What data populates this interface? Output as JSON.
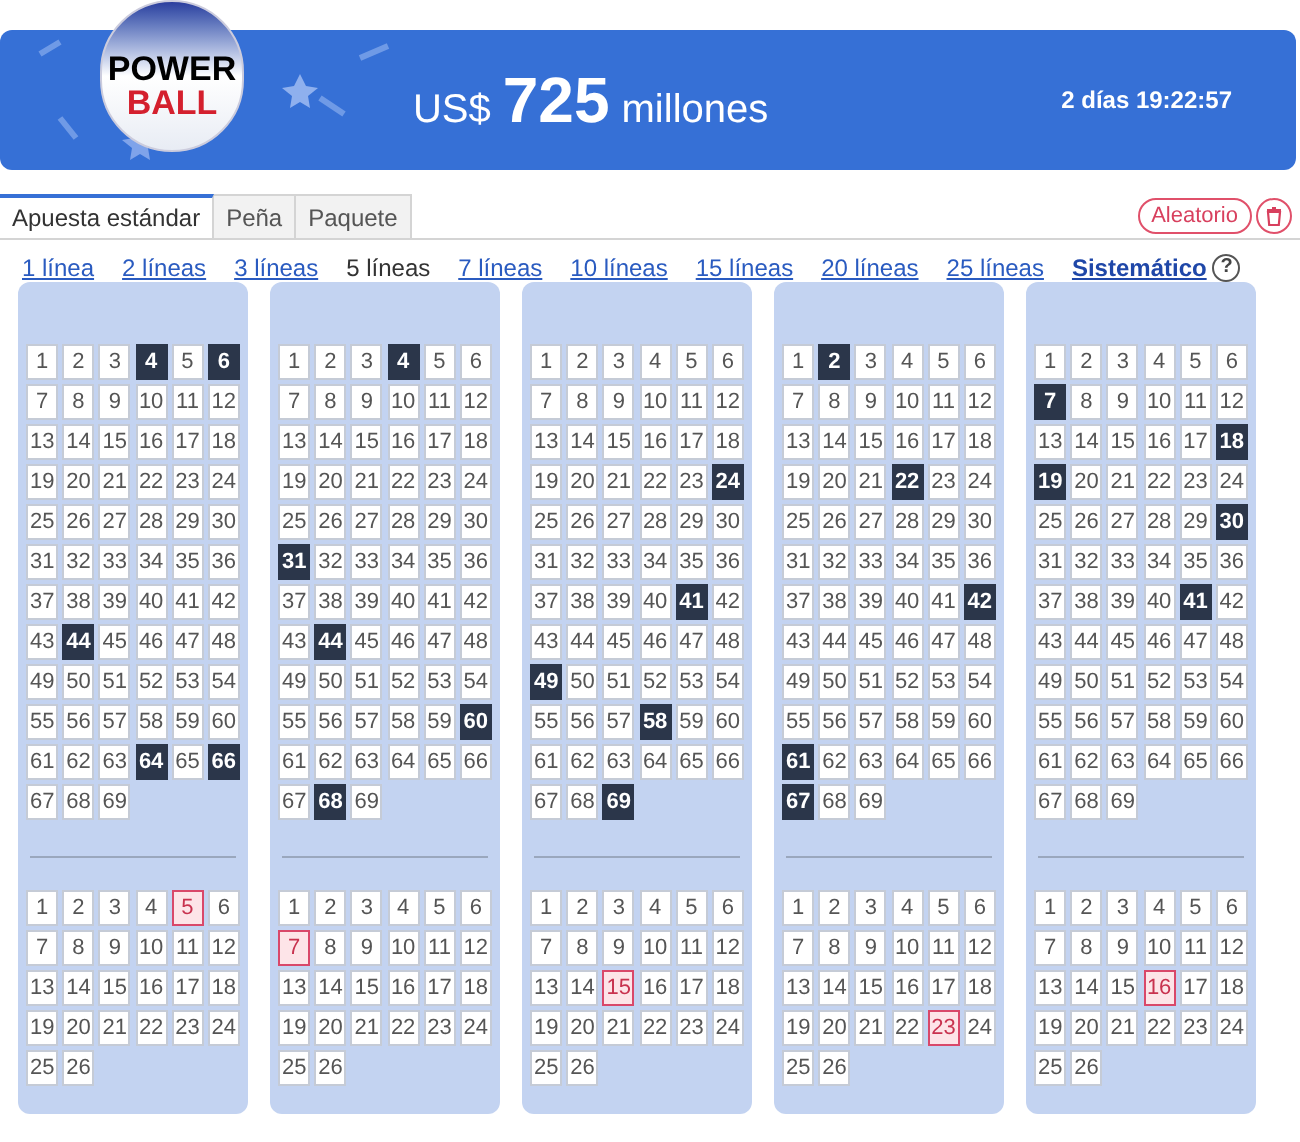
{
  "header": {
    "logo_top": "POWER",
    "logo_bottom": "BALL",
    "currency": "US$",
    "amount": "725",
    "unit": "millones",
    "countdown": "2 días 19:22:57"
  },
  "tabs": [
    {
      "label": "Apuesta estándar",
      "selected": true
    },
    {
      "label": "Peña",
      "selected": false
    },
    {
      "label": "Paquete",
      "selected": false
    }
  ],
  "actions": {
    "random": "Aleatorio"
  },
  "line_options": [
    {
      "label": "1 línea",
      "selected": false
    },
    {
      "label": "2 líneas",
      "selected": false
    },
    {
      "label": "3 líneas",
      "selected": false
    },
    {
      "label": "5 líneas",
      "selected": true
    },
    {
      "label": "7 líneas",
      "selected": false
    },
    {
      "label": "10 líneas",
      "selected": false
    },
    {
      "label": "15 líneas",
      "selected": false
    },
    {
      "label": "20 líneas",
      "selected": false
    },
    {
      "label": "25 líneas",
      "selected": false
    }
  ],
  "system_link": "Sistemático",
  "help": "?",
  "tickets": [
    {
      "main": [
        {
          "label": "1",
          "selected": false
        },
        {
          "label": "2",
          "selected": false
        },
        {
          "label": "3",
          "selected": false
        },
        {
          "label": "4",
          "selected": true
        },
        {
          "label": "5",
          "selected": false
        },
        {
          "label": "6",
          "selected": true
        },
        {
          "label": "7",
          "selected": false
        },
        {
          "label": "8",
          "selected": false
        },
        {
          "label": "9",
          "selected": false
        },
        {
          "label": "10",
          "selected": false
        },
        {
          "label": "11",
          "selected": false
        },
        {
          "label": "12",
          "selected": false
        },
        {
          "label": "13",
          "selected": false
        },
        {
          "label": "14",
          "selected": false
        },
        {
          "label": "15",
          "selected": false
        },
        {
          "label": "16",
          "selected": false
        },
        {
          "label": "17",
          "selected": false
        },
        {
          "label": "18",
          "selected": false
        },
        {
          "label": "19",
          "selected": false
        },
        {
          "label": "20",
          "selected": false
        },
        {
          "label": "21",
          "selected": false
        },
        {
          "label": "22",
          "selected": false
        },
        {
          "label": "23",
          "selected": false
        },
        {
          "label": "24",
          "selected": false
        },
        {
          "label": "25",
          "selected": false
        },
        {
          "label": "26",
          "selected": false
        },
        {
          "label": "27",
          "selected": false
        },
        {
          "label": "28",
          "selected": false
        },
        {
          "label": "29",
          "selected": false
        },
        {
          "label": "30",
          "selected": false
        },
        {
          "label": "31",
          "selected": false
        },
        {
          "label": "32",
          "selected": false
        },
        {
          "label": "33",
          "selected": false
        },
        {
          "label": "34",
          "selected": false
        },
        {
          "label": "35",
          "selected": false
        },
        {
          "label": "36",
          "selected": false
        },
        {
          "label": "37",
          "selected": false
        },
        {
          "label": "38",
          "selected": false
        },
        {
          "label": "39",
          "selected": false
        },
        {
          "label": "40",
          "selected": false
        },
        {
          "label": "41",
          "selected": false
        },
        {
          "label": "42",
          "selected": false
        },
        {
          "label": "43",
          "selected": false
        },
        {
          "label": "44",
          "selected": true
        },
        {
          "label": "45",
          "selected": false
        },
        {
          "label": "46",
          "selected": false
        },
        {
          "label": "47",
          "selected": false
        },
        {
          "label": "48",
          "selected": false
        },
        {
          "label": "49",
          "selected": false
        },
        {
          "label": "50",
          "selected": false
        },
        {
          "label": "51",
          "selected": false
        },
        {
          "label": "52",
          "selected": false
        },
        {
          "label": "53",
          "selected": false
        },
        {
          "label": "54",
          "selected": false
        },
        {
          "label": "55",
          "selected": false
        },
        {
          "label": "56",
          "selected": false
        },
        {
          "label": "57",
          "selected": false
        },
        {
          "label": "58",
          "selected": false
        },
        {
          "label": "59",
          "selected": false
        },
        {
          "label": "60",
          "selected": false
        },
        {
          "label": "61",
          "selected": false
        },
        {
          "label": "62",
          "selected": false
        },
        {
          "label": "63",
          "selected": false
        },
        {
          "label": "64",
          "selected": true
        },
        {
          "label": "65",
          "selected": false
        },
        {
          "label": "66",
          "selected": true
        },
        {
          "label": "67",
          "selected": false
        },
        {
          "label": "68",
          "selected": false
        },
        {
          "label": "69",
          "selected": false
        }
      ],
      "powerball": [
        {
          "label": "1",
          "selected": false
        },
        {
          "label": "2",
          "selected": false
        },
        {
          "label": "3",
          "selected": false
        },
        {
          "label": "4",
          "selected": false
        },
        {
          "label": "5",
          "selected": true
        },
        {
          "label": "6",
          "selected": false
        },
        {
          "label": "7",
          "selected": false
        },
        {
          "label": "8",
          "selected": false
        },
        {
          "label": "9",
          "selected": false
        },
        {
          "label": "10",
          "selected": false
        },
        {
          "label": "11",
          "selected": false
        },
        {
          "label": "12",
          "selected": false
        },
        {
          "label": "13",
          "selected": false
        },
        {
          "label": "14",
          "selected": false
        },
        {
          "label": "15",
          "selected": false
        },
        {
          "label": "16",
          "selected": false
        },
        {
          "label": "17",
          "selected": false
        },
        {
          "label": "18",
          "selected": false
        },
        {
          "label": "19",
          "selected": false
        },
        {
          "label": "20",
          "selected": false
        },
        {
          "label": "21",
          "selected": false
        },
        {
          "label": "22",
          "selected": false
        },
        {
          "label": "23",
          "selected": false
        },
        {
          "label": "24",
          "selected": false
        },
        {
          "label": "25",
          "selected": false
        },
        {
          "label": "26",
          "selected": false
        }
      ]
    },
    {
      "main": [
        {
          "label": "1",
          "selected": false
        },
        {
          "label": "2",
          "selected": false
        },
        {
          "label": "3",
          "selected": false
        },
        {
          "label": "4",
          "selected": true
        },
        {
          "label": "5",
          "selected": false
        },
        {
          "label": "6",
          "selected": false
        },
        {
          "label": "7",
          "selected": false
        },
        {
          "label": "8",
          "selected": false
        },
        {
          "label": "9",
          "selected": false
        },
        {
          "label": "10",
          "selected": false
        },
        {
          "label": "11",
          "selected": false
        },
        {
          "label": "12",
          "selected": false
        },
        {
          "label": "13",
          "selected": false
        },
        {
          "label": "14",
          "selected": false
        },
        {
          "label": "15",
          "selected": false
        },
        {
          "label": "16",
          "selected": false
        },
        {
          "label": "17",
          "selected": false
        },
        {
          "label": "18",
          "selected": false
        },
        {
          "label": "19",
          "selected": false
        },
        {
          "label": "20",
          "selected": false
        },
        {
          "label": "21",
          "selected": false
        },
        {
          "label": "22",
          "selected": false
        },
        {
          "label": "23",
          "selected": false
        },
        {
          "label": "24",
          "selected": false
        },
        {
          "label": "25",
          "selected": false
        },
        {
          "label": "26",
          "selected": false
        },
        {
          "label": "27",
          "selected": false
        },
        {
          "label": "28",
          "selected": false
        },
        {
          "label": "29",
          "selected": false
        },
        {
          "label": "30",
          "selected": false
        },
        {
          "label": "31",
          "selected": true
        },
        {
          "label": "32",
          "selected": false
        },
        {
          "label": "33",
          "selected": false
        },
        {
          "label": "34",
          "selected": false
        },
        {
          "label": "35",
          "selected": false
        },
        {
          "label": "36",
          "selected": false
        },
        {
          "label": "37",
          "selected": false
        },
        {
          "label": "38",
          "selected": false
        },
        {
          "label": "39",
          "selected": false
        },
        {
          "label": "40",
          "selected": false
        },
        {
          "label": "41",
          "selected": false
        },
        {
          "label": "42",
          "selected": false
        },
        {
          "label": "43",
          "selected": false
        },
        {
          "label": "44",
          "selected": true
        },
        {
          "label": "45",
          "selected": false
        },
        {
          "label": "46",
          "selected": false
        },
        {
          "label": "47",
          "selected": false
        },
        {
          "label": "48",
          "selected": false
        },
        {
          "label": "49",
          "selected": false
        },
        {
          "label": "50",
          "selected": false
        },
        {
          "label": "51",
          "selected": false
        },
        {
          "label": "52",
          "selected": false
        },
        {
          "label": "53",
          "selected": false
        },
        {
          "label": "54",
          "selected": false
        },
        {
          "label": "55",
          "selected": false
        },
        {
          "label": "56",
          "selected": false
        },
        {
          "label": "57",
          "selected": false
        },
        {
          "label": "58",
          "selected": false
        },
        {
          "label": "59",
          "selected": false
        },
        {
          "label": "60",
          "selected": true
        },
        {
          "label": "61",
          "selected": false
        },
        {
          "label": "62",
          "selected": false
        },
        {
          "label": "63",
          "selected": false
        },
        {
          "label": "64",
          "selected": false
        },
        {
          "label": "65",
          "selected": false
        },
        {
          "label": "66",
          "selected": false
        },
        {
          "label": "67",
          "selected": false
        },
        {
          "label": "68",
          "selected": true
        },
        {
          "label": "69",
          "selected": false
        }
      ],
      "powerball": [
        {
          "label": "1",
          "selected": false
        },
        {
          "label": "2",
          "selected": false
        },
        {
          "label": "3",
          "selected": false
        },
        {
          "label": "4",
          "selected": false
        },
        {
          "label": "5",
          "selected": false
        },
        {
          "label": "6",
          "selected": false
        },
        {
          "label": "7",
          "selected": true
        },
        {
          "label": "8",
          "selected": false
        },
        {
          "label": "9",
          "selected": false
        },
        {
          "label": "10",
          "selected": false
        },
        {
          "label": "11",
          "selected": false
        },
        {
          "label": "12",
          "selected": false
        },
        {
          "label": "13",
          "selected": false
        },
        {
          "label": "14",
          "selected": false
        },
        {
          "label": "15",
          "selected": false
        },
        {
          "label": "16",
          "selected": false
        },
        {
          "label": "17",
          "selected": false
        },
        {
          "label": "18",
          "selected": false
        },
        {
          "label": "19",
          "selected": false
        },
        {
          "label": "20",
          "selected": false
        },
        {
          "label": "21",
          "selected": false
        },
        {
          "label": "22",
          "selected": false
        },
        {
          "label": "23",
          "selected": false
        },
        {
          "label": "24",
          "selected": false
        },
        {
          "label": "25",
          "selected": false
        },
        {
          "label": "26",
          "selected": false
        }
      ]
    },
    {
      "main": [
        {
          "label": "1",
          "selected": false
        },
        {
          "label": "2",
          "selected": false
        },
        {
          "label": "3",
          "selected": false
        },
        {
          "label": "4",
          "selected": false
        },
        {
          "label": "5",
          "selected": false
        },
        {
          "label": "6",
          "selected": false
        },
        {
          "label": "7",
          "selected": false
        },
        {
          "label": "8",
          "selected": false
        },
        {
          "label": "9",
          "selected": false
        },
        {
          "label": "10",
          "selected": false
        },
        {
          "label": "11",
          "selected": false
        },
        {
          "label": "12",
          "selected": false
        },
        {
          "label": "13",
          "selected": false
        },
        {
          "label": "14",
          "selected": false
        },
        {
          "label": "15",
          "selected": false
        },
        {
          "label": "16",
          "selected": false
        },
        {
          "label": "17",
          "selected": false
        },
        {
          "label": "18",
          "selected": false
        },
        {
          "label": "19",
          "selected": false
        },
        {
          "label": "20",
          "selected": false
        },
        {
          "label": "21",
          "selected": false
        },
        {
          "label": "22",
          "selected": false
        },
        {
          "label": "23",
          "selected": false
        },
        {
          "label": "24",
          "selected": true
        },
        {
          "label": "25",
          "selected": false
        },
        {
          "label": "26",
          "selected": false
        },
        {
          "label": "27",
          "selected": false
        },
        {
          "label": "28",
          "selected": false
        },
        {
          "label": "29",
          "selected": false
        },
        {
          "label": "30",
          "selected": false
        },
        {
          "label": "31",
          "selected": false
        },
        {
          "label": "32",
          "selected": false
        },
        {
          "label": "33",
          "selected": false
        },
        {
          "label": "34",
          "selected": false
        },
        {
          "label": "35",
          "selected": false
        },
        {
          "label": "36",
          "selected": false
        },
        {
          "label": "37",
          "selected": false
        },
        {
          "label": "38",
          "selected": false
        },
        {
          "label": "39",
          "selected": false
        },
        {
          "label": "40",
          "selected": false
        },
        {
          "label": "41",
          "selected": true
        },
        {
          "label": "42",
          "selected": false
        },
        {
          "label": "43",
          "selected": false
        },
        {
          "label": "44",
          "selected": false
        },
        {
          "label": "45",
          "selected": false
        },
        {
          "label": "46",
          "selected": false
        },
        {
          "label": "47",
          "selected": false
        },
        {
          "label": "48",
          "selected": false
        },
        {
          "label": "49",
          "selected": true
        },
        {
          "label": "50",
          "selected": false
        },
        {
          "label": "51",
          "selected": false
        },
        {
          "label": "52",
          "selected": false
        },
        {
          "label": "53",
          "selected": false
        },
        {
          "label": "54",
          "selected": false
        },
        {
          "label": "55",
          "selected": false
        },
        {
          "label": "56",
          "selected": false
        },
        {
          "label": "57",
          "selected": false
        },
        {
          "label": "58",
          "selected": true
        },
        {
          "label": "59",
          "selected": false
        },
        {
          "label": "60",
          "selected": false
        },
        {
          "label": "61",
          "selected": false
        },
        {
          "label": "62",
          "selected": false
        },
        {
          "label": "63",
          "selected": false
        },
        {
          "label": "64",
          "selected": false
        },
        {
          "label": "65",
          "selected": false
        },
        {
          "label": "66",
          "selected": false
        },
        {
          "label": "67",
          "selected": false
        },
        {
          "label": "68",
          "selected": false
        },
        {
          "label": "69",
          "selected": true
        }
      ],
      "powerball": [
        {
          "label": "1",
          "selected": false
        },
        {
          "label": "2",
          "selected": false
        },
        {
          "label": "3",
          "selected": false
        },
        {
          "label": "4",
          "selected": false
        },
        {
          "label": "5",
          "selected": false
        },
        {
          "label": "6",
          "selected": false
        },
        {
          "label": "7",
          "selected": false
        },
        {
          "label": "8",
          "selected": false
        },
        {
          "label": "9",
          "selected": false
        },
        {
          "label": "10",
          "selected": false
        },
        {
          "label": "11",
          "selected": false
        },
        {
          "label": "12",
          "selected": false
        },
        {
          "label": "13",
          "selected": false
        },
        {
          "label": "14",
          "selected": false
        },
        {
          "label": "15",
          "selected": true
        },
        {
          "label": "16",
          "selected": false
        },
        {
          "label": "17",
          "selected": false
        },
        {
          "label": "18",
          "selected": false
        },
        {
          "label": "19",
          "selected": false
        },
        {
          "label": "20",
          "selected": false
        },
        {
          "label": "21",
          "selected": false
        },
        {
          "label": "22",
          "selected": false
        },
        {
          "label": "23",
          "selected": false
        },
        {
          "label": "24",
          "selected": false
        },
        {
          "label": "25",
          "selected": false
        },
        {
          "label": "26",
          "selected": false
        }
      ]
    },
    {
      "main": [
        {
          "label": "1",
          "selected": false
        },
        {
          "label": "2",
          "selected": true
        },
        {
          "label": "3",
          "selected": false
        },
        {
          "label": "4",
          "selected": false
        },
        {
          "label": "5",
          "selected": false
        },
        {
          "label": "6",
          "selected": false
        },
        {
          "label": "7",
          "selected": false
        },
        {
          "label": "8",
          "selected": false
        },
        {
          "label": "9",
          "selected": false
        },
        {
          "label": "10",
          "selected": false
        },
        {
          "label": "11",
          "selected": false
        },
        {
          "label": "12",
          "selected": false
        },
        {
          "label": "13",
          "selected": false
        },
        {
          "label": "14",
          "selected": false
        },
        {
          "label": "15",
          "selected": false
        },
        {
          "label": "16",
          "selected": false
        },
        {
          "label": "17",
          "selected": false
        },
        {
          "label": "18",
          "selected": false
        },
        {
          "label": "19",
          "selected": false
        },
        {
          "label": "20",
          "selected": false
        },
        {
          "label": "21",
          "selected": false
        },
        {
          "label": "22",
          "selected": true
        },
        {
          "label": "23",
          "selected": false
        },
        {
          "label": "24",
          "selected": false
        },
        {
          "label": "25",
          "selected": false
        },
        {
          "label": "26",
          "selected": false
        },
        {
          "label": "27",
          "selected": false
        },
        {
          "label": "28",
          "selected": false
        },
        {
          "label": "29",
          "selected": false
        },
        {
          "label": "30",
          "selected": false
        },
        {
          "label": "31",
          "selected": false
        },
        {
          "label": "32",
          "selected": false
        },
        {
          "label": "33",
          "selected": false
        },
        {
          "label": "34",
          "selected": false
        },
        {
          "label": "35",
          "selected": false
        },
        {
          "label": "36",
          "selected": false
        },
        {
          "label": "37",
          "selected": false
        },
        {
          "label": "38",
          "selected": false
        },
        {
          "label": "39",
          "selected": false
        },
        {
          "label": "40",
          "selected": false
        },
        {
          "label": "41",
          "selected": false
        },
        {
          "label": "42",
          "selected": true
        },
        {
          "label": "43",
          "selected": false
        },
        {
          "label": "44",
          "selected": false
        },
        {
          "label": "45",
          "selected": false
        },
        {
          "label": "46",
          "selected": false
        },
        {
          "label": "47",
          "selected": false
        },
        {
          "label": "48",
          "selected": false
        },
        {
          "label": "49",
          "selected": false
        },
        {
          "label": "50",
          "selected": false
        },
        {
          "label": "51",
          "selected": false
        },
        {
          "label": "52",
          "selected": false
        },
        {
          "label": "53",
          "selected": false
        },
        {
          "label": "54",
          "selected": false
        },
        {
          "label": "55",
          "selected": false
        },
        {
          "label": "56",
          "selected": false
        },
        {
          "label": "57",
          "selected": false
        },
        {
          "label": "58",
          "selected": false
        },
        {
          "label": "59",
          "selected": false
        },
        {
          "label": "60",
          "selected": false
        },
        {
          "label": "61",
          "selected": true
        },
        {
          "label": "62",
          "selected": false
        },
        {
          "label": "63",
          "selected": false
        },
        {
          "label": "64",
          "selected": false
        },
        {
          "label": "65",
          "selected": false
        },
        {
          "label": "66",
          "selected": false
        },
        {
          "label": "67",
          "selected": true
        },
        {
          "label": "68",
          "selected": false
        },
        {
          "label": "69",
          "selected": false
        }
      ],
      "powerball": [
        {
          "label": "1",
          "selected": false
        },
        {
          "label": "2",
          "selected": false
        },
        {
          "label": "3",
          "selected": false
        },
        {
          "label": "4",
          "selected": false
        },
        {
          "label": "5",
          "selected": false
        },
        {
          "label": "6",
          "selected": false
        },
        {
          "label": "7",
          "selected": false
        },
        {
          "label": "8",
          "selected": false
        },
        {
          "label": "9",
          "selected": false
        },
        {
          "label": "10",
          "selected": false
        },
        {
          "label": "11",
          "selected": false
        },
        {
          "label": "12",
          "selected": false
        },
        {
          "label": "13",
          "selected": false
        },
        {
          "label": "14",
          "selected": false
        },
        {
          "label": "15",
          "selected": false
        },
        {
          "label": "16",
          "selected": false
        },
        {
          "label": "17",
          "selected": false
        },
        {
          "label": "18",
          "selected": false
        },
        {
          "label": "19",
          "selected": false
        },
        {
          "label": "20",
          "selected": false
        },
        {
          "label": "21",
          "selected": false
        },
        {
          "label": "22",
          "selected": false
        },
        {
          "label": "23",
          "selected": true
        },
        {
          "label": "24",
          "selected": false
        },
        {
          "label": "25",
          "selected": false
        },
        {
          "label": "26",
          "selected": false
        }
      ]
    },
    {
      "main": [
        {
          "label": "1",
          "selected": false
        },
        {
          "label": "2",
          "selected": false
        },
        {
          "label": "3",
          "selected": false
        },
        {
          "label": "4",
          "selected": false
        },
        {
          "label": "5",
          "selected": false
        },
        {
          "label": "6",
          "selected": false
        },
        {
          "label": "7",
          "selected": true
        },
        {
          "label": "8",
          "selected": false
        },
        {
          "label": "9",
          "selected": false
        },
        {
          "label": "10",
          "selected": false
        },
        {
          "label": "11",
          "selected": false
        },
        {
          "label": "12",
          "selected": false
        },
        {
          "label": "13",
          "selected": false
        },
        {
          "label": "14",
          "selected": false
        },
        {
          "label": "15",
          "selected": false
        },
        {
          "label": "16",
          "selected": false
        },
        {
          "label": "17",
          "selected": false
        },
        {
          "label": "18",
          "selected": true
        },
        {
          "label": "19",
          "selected": true
        },
        {
          "label": "20",
          "selected": false
        },
        {
          "label": "21",
          "selected": false
        },
        {
          "label": "22",
          "selected": false
        },
        {
          "label": "23",
          "selected": false
        },
        {
          "label": "24",
          "selected": false
        },
        {
          "label": "25",
          "selected": false
        },
        {
          "label": "26",
          "selected": false
        },
        {
          "label": "27",
          "selected": false
        },
        {
          "label": "28",
          "selected": false
        },
        {
          "label": "29",
          "selected": false
        },
        {
          "label": "30",
          "selected": true
        },
        {
          "label": "31",
          "selected": false
        },
        {
          "label": "32",
          "selected": false
        },
        {
          "label": "33",
          "selected": false
        },
        {
          "label": "34",
          "selected": false
        },
        {
          "label": "35",
          "selected": false
        },
        {
          "label": "36",
          "selected": false
        },
        {
          "label": "37",
          "selected": false
        },
        {
          "label": "38",
          "selected": false
        },
        {
          "label": "39",
          "selected": false
        },
        {
          "label": "40",
          "selected": false
        },
        {
          "label": "41",
          "selected": true
        },
        {
          "label": "42",
          "selected": false
        },
        {
          "label": "43",
          "selected": false
        },
        {
          "label": "44",
          "selected": false
        },
        {
          "label": "45",
          "selected": false
        },
        {
          "label": "46",
          "selected": false
        },
        {
          "label": "47",
          "selected": false
        },
        {
          "label": "48",
          "selected": false
        },
        {
          "label": "49",
          "selected": false
        },
        {
          "label": "50",
          "selected": false
        },
        {
          "label": "51",
          "selected": false
        },
        {
          "label": "52",
          "selected": false
        },
        {
          "label": "53",
          "selected": false
        },
        {
          "label": "54",
          "selected": false
        },
        {
          "label": "55",
          "selected": false
        },
        {
          "label": "56",
          "selected": false
        },
        {
          "label": "57",
          "selected": false
        },
        {
          "label": "58",
          "selected": false
        },
        {
          "label": "59",
          "selected": false
        },
        {
          "label": "60",
          "selected": false
        },
        {
          "label": "61",
          "selected": false
        },
        {
          "label": "62",
          "selected": false
        },
        {
          "label": "63",
          "selected": false
        },
        {
          "label": "64",
          "selected": false
        },
        {
          "label": "65",
          "selected": false
        },
        {
          "label": "66",
          "selected": false
        },
        {
          "label": "67",
          "selected": false
        },
        {
          "label": "68",
          "selected": false
        },
        {
          "label": "69",
          "selected": false
        }
      ],
      "powerball": [
        {
          "label": "1",
          "selected": false
        },
        {
          "label": "2",
          "selected": false
        },
        {
          "label": "3",
          "selected": false
        },
        {
          "label": "4",
          "selected": false
        },
        {
          "label": "5",
          "selected": false
        },
        {
          "label": "6",
          "selected": false
        },
        {
          "label": "7",
          "selected": false
        },
        {
          "label": "8",
          "selected": false
        },
        {
          "label": "9",
          "selected": false
        },
        {
          "label": "10",
          "selected": false
        },
        {
          "label": "11",
          "selected": false
        },
        {
          "label": "12",
          "selected": false
        },
        {
          "label": "13",
          "selected": false
        },
        {
          "label": "14",
          "selected": false
        },
        {
          "label": "15",
          "selected": false
        },
        {
          "label": "16",
          "selected": true
        },
        {
          "label": "17",
          "selected": false
        },
        {
          "label": "18",
          "selected": false
        },
        {
          "label": "19",
          "selected": false
        },
        {
          "label": "20",
          "selected": false
        },
        {
          "label": "21",
          "selected": false
        },
        {
          "label": "22",
          "selected": false
        },
        {
          "label": "23",
          "selected": false
        },
        {
          "label": "24",
          "selected": false
        },
        {
          "label": "25",
          "selected": false
        },
        {
          "label": "26",
          "selected": false
        }
      ]
    }
  ]
}
